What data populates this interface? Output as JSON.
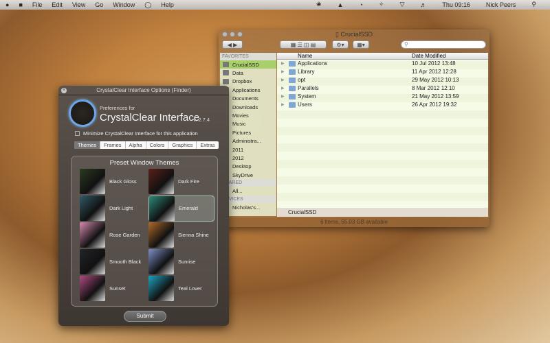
{
  "menubar": {
    "items": [
      "File",
      "Edit",
      "View",
      "Go",
      "Window",
      "Help"
    ],
    "clock": "Thu 09:16",
    "user": "Nick Peers"
  },
  "finder": {
    "title": "CrucialSSD",
    "search_placeholder": "",
    "sidebar": {
      "favorites_header": "FAVORITES",
      "favorites": [
        "CrucialSSD",
        "Data",
        "Dropbox",
        "Applications",
        "Documents",
        "Downloads",
        "Movies",
        "Music",
        "Pictures",
        "Administra...",
        "2011",
        "2012",
        "Desktop",
        "SkyDrive"
      ],
      "shared_header": "SHARED",
      "shared": [
        "All..."
      ],
      "devices_header": "DEVICES",
      "devices": [
        "Nicholas's..."
      ]
    },
    "columns": {
      "name": "Name",
      "date": "Date Modified"
    },
    "rows": [
      {
        "name": "Applications",
        "date": "10 Jul 2012 13:48"
      },
      {
        "name": "Library",
        "date": "11 Apr 2012 12:28"
      },
      {
        "name": "opt",
        "date": "29 May 2012 10:13"
      },
      {
        "name": "Parallels",
        "date": "8 Mar 2012 12:10"
      },
      {
        "name": "System",
        "date": "21 May 2012 13:59"
      },
      {
        "name": "Users",
        "date": "26 Apr 2012 19:32"
      }
    ],
    "path": "CrucialSSD",
    "status": "6 items, 55.03 GB available"
  },
  "cc": {
    "title": "CrystalClear Interface Options (Finder)",
    "prefs_for": "Preferences for",
    "app_name": "CrystalClear Interface",
    "version": "v. 2.7.4",
    "minimize_label": "Minimize CrystalClear Interface for this application",
    "minimize_checked": false,
    "tabs": [
      "Themes",
      "Frames",
      "Alpha",
      "Colors",
      "Graphics",
      "Extras"
    ],
    "active_tab": "Themes",
    "panel_title": "Preset Window Themes",
    "selected_theme": "Emerald",
    "themes": [
      {
        "name": "Black Gloss",
        "color": "#2a3a20"
      },
      {
        "name": "Dark Fire",
        "color": "#5a2018"
      },
      {
        "name": "Dark Light",
        "color": "#2f5a66"
      },
      {
        "name": "Emerald",
        "color": "#2a8a7a"
      },
      {
        "name": "Rose Garden",
        "color": "#d78ab0"
      },
      {
        "name": "Sienna Shine",
        "color": "#b06a2a"
      },
      {
        "name": "Smooth Black",
        "color": "#222428"
      },
      {
        "name": "Sunrise",
        "color": "#7d8fc8"
      },
      {
        "name": "Sunset",
        "color": "#b04a80"
      },
      {
        "name": "Teal Lover",
        "color": "#1ea3c2"
      }
    ],
    "submit": "Submit"
  }
}
